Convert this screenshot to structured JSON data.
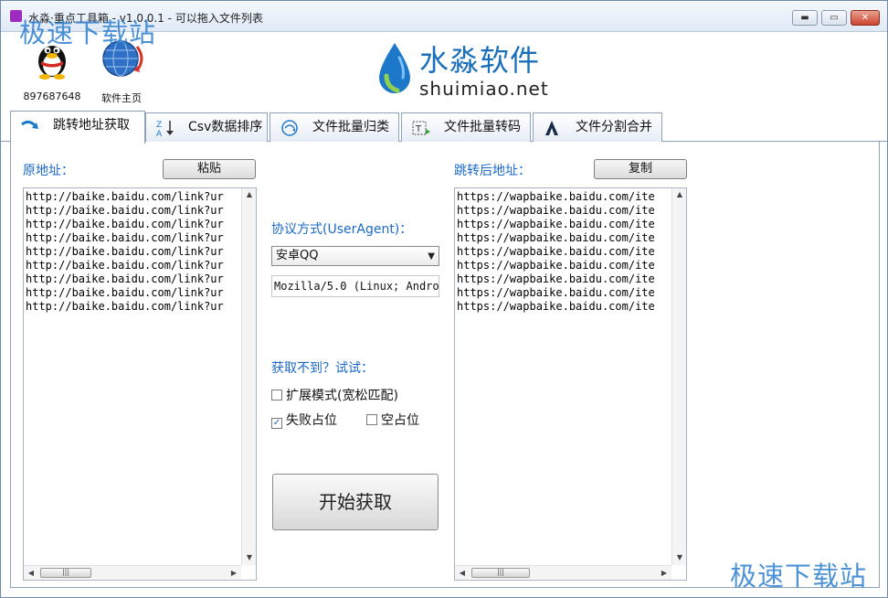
{
  "window": {
    "title": "水淼·重点工具箱 - v1.0.0.1 - 可以拖入文件列表",
    "minimize": "▬",
    "maximize": "▭",
    "close": "✕"
  },
  "watermark": {
    "top": "极速下载站",
    "bottom": "极速下载站"
  },
  "header": {
    "qq_number": "897687648",
    "homepage_label": "软件主页",
    "brand_cn": "水淼软件",
    "brand_en": "shuimiao.net"
  },
  "tabs": [
    {
      "label": "跳转地址获取",
      "icon": "redirect-arrow-icon",
      "active": true
    },
    {
      "label": "Csv数据排序",
      "icon": "sort-za-icon",
      "active": false
    },
    {
      "label": "文件批量归类",
      "icon": "classify-icon",
      "active": false
    },
    {
      "label": "文件批量转码",
      "icon": "transcode-icon",
      "active": false
    },
    {
      "label": "文件分割合并",
      "icon": "split-merge-icon",
      "active": false
    }
  ],
  "left": {
    "label": "原地址：",
    "paste_button": "粘贴",
    "lines": [
      "http://baike.baidu.com/link?ur",
      "http://baike.baidu.com/link?ur",
      "http://baike.baidu.com/link?ur",
      "http://baike.baidu.com/link?ur",
      "http://baike.baidu.com/link?ur",
      "http://baike.baidu.com/link?ur",
      "http://baike.baidu.com/link?ur",
      "http://baike.baidu.com/link?ur",
      "http://baike.baidu.com/link?ur"
    ]
  },
  "middle": {
    "protocol_label": "协议方式(UserAgent)：",
    "protocol_selected": "安卓QQ",
    "user_agent": "Mozilla/5.0 (Linux; Android",
    "retry_label": "获取不到？试试：",
    "option_extend": {
      "label": "扩展模式(宽松匹配)",
      "checked": false
    },
    "option_fail_placeholder": {
      "label": "失败占位",
      "checked": true
    },
    "option_empty_placeholder": {
      "label": "空占位",
      "checked": false
    },
    "start_button": "开始获取"
  },
  "right": {
    "label": "跳转后地址：",
    "copy_button": "复制",
    "lines": [
      "https://wapbaike.baidu.com/ite",
      "https://wapbaike.baidu.com/ite",
      "https://wapbaike.baidu.com/ite",
      "https://wapbaike.baidu.com/ite",
      "https://wapbaike.baidu.com/ite",
      "https://wapbaike.baidu.com/ite",
      "https://wapbaike.baidu.com/ite",
      "https://wapbaike.baidu.com/ite",
      "https://wapbaike.baidu.com/ite"
    ]
  },
  "scroll": {
    "up": "▲",
    "down": "▼",
    "left": "◀",
    "right": "▶",
    "grip": "|||"
  },
  "colors": {
    "accent_label": "#1c68c6",
    "brand_blue": "#1a6fb8",
    "close_red": "#c9422f"
  }
}
